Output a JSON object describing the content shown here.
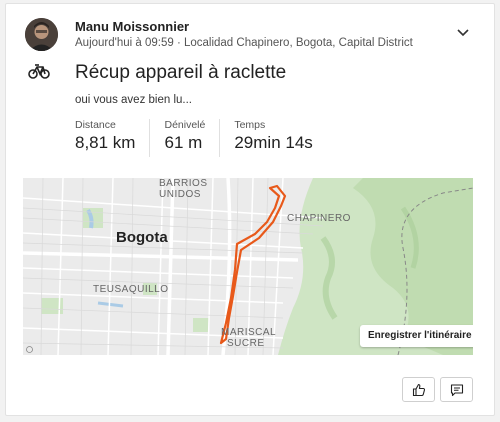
{
  "activity": {
    "athlete_name": "Manu Moissonnier",
    "meta": "Aujourd'hui à 09:59 · Localidad Chapinero, Bogota, Capital District",
    "sport_icon": "bike-icon",
    "title": "Récup appareil à raclette",
    "description": "oui vous avez bien lu...",
    "stats": [
      {
        "label": "Distance",
        "value": "8,81 km"
      },
      {
        "label": "Dénivelé",
        "value": "61 m"
      },
      {
        "label": "Temps",
        "value": "29min 14s"
      }
    ]
  },
  "map": {
    "labels": {
      "barrios_unidos": [
        "BARRIOS",
        "UNIDOS"
      ],
      "bogota": "Bogota",
      "chapinero": "CHAPINERO",
      "teusaquillo": "TEUSAQUILLO",
      "mariscal_sucre": [
        "MARISCAL",
        "SUCRE"
      ]
    },
    "save_route_label": "Enregistrer l'itinéraire",
    "route_color": "#e8591a",
    "park_color": "#cfe5c4",
    "info_icon": "info-icon"
  },
  "actions": {
    "kudos_icon": "thumbs-up-icon",
    "comment_icon": "comment-icon"
  }
}
